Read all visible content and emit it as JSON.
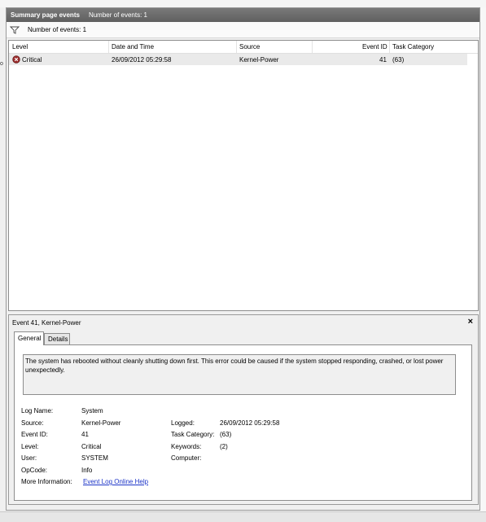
{
  "titlebar": {
    "title": "Summary page events",
    "count": "Number of events: 1"
  },
  "subbar": {
    "count": "Number of events: 1"
  },
  "table": {
    "columns": [
      "Level",
      "Date and Time",
      "Source",
      "Event ID",
      "Task Category"
    ],
    "rows": [
      {
        "level": "Critical",
        "datetime": "26/09/2012 05:29:58",
        "source": "Kernel-Power",
        "event_id": "41",
        "task_category": "(63)"
      }
    ]
  },
  "detail": {
    "title": "Event 41, Kernel-Power",
    "close": "×",
    "tabs": [
      "General",
      "Details"
    ],
    "description": "The system has rebooted without cleanly shutting down first. This error could be caused if the system stopped responding, crashed, or lost power unexpectedly.",
    "fields": {
      "log_name_label": "Log Name:",
      "log_name": "System",
      "source_label": "Source:",
      "source": "Kernel-Power",
      "event_id_label": "Event ID:",
      "event_id": "41",
      "level_label": "Level:",
      "level": "Critical",
      "user_label": "User:",
      "user": "SYSTEM",
      "opcode_label": "OpCode:",
      "opcode": "Info",
      "more_info_label": "More Information:",
      "more_info_link": "Event Log Online Help",
      "logged_label": "Logged:",
      "logged": "26/09/2012 05:29:58",
      "task_category_label": "Task Category:",
      "task_category": "(63)",
      "keywords_label": "Keywords:",
      "keywords": "(2)",
      "computer_label": "Computer:",
      "computer": ""
    }
  },
  "edge_mark": "o",
  "colors": {
    "titlebar": "#6b6b6b",
    "critical": "#9b2b2b",
    "link": "#1d35c8",
    "row_highlight": "#eaeaea"
  }
}
